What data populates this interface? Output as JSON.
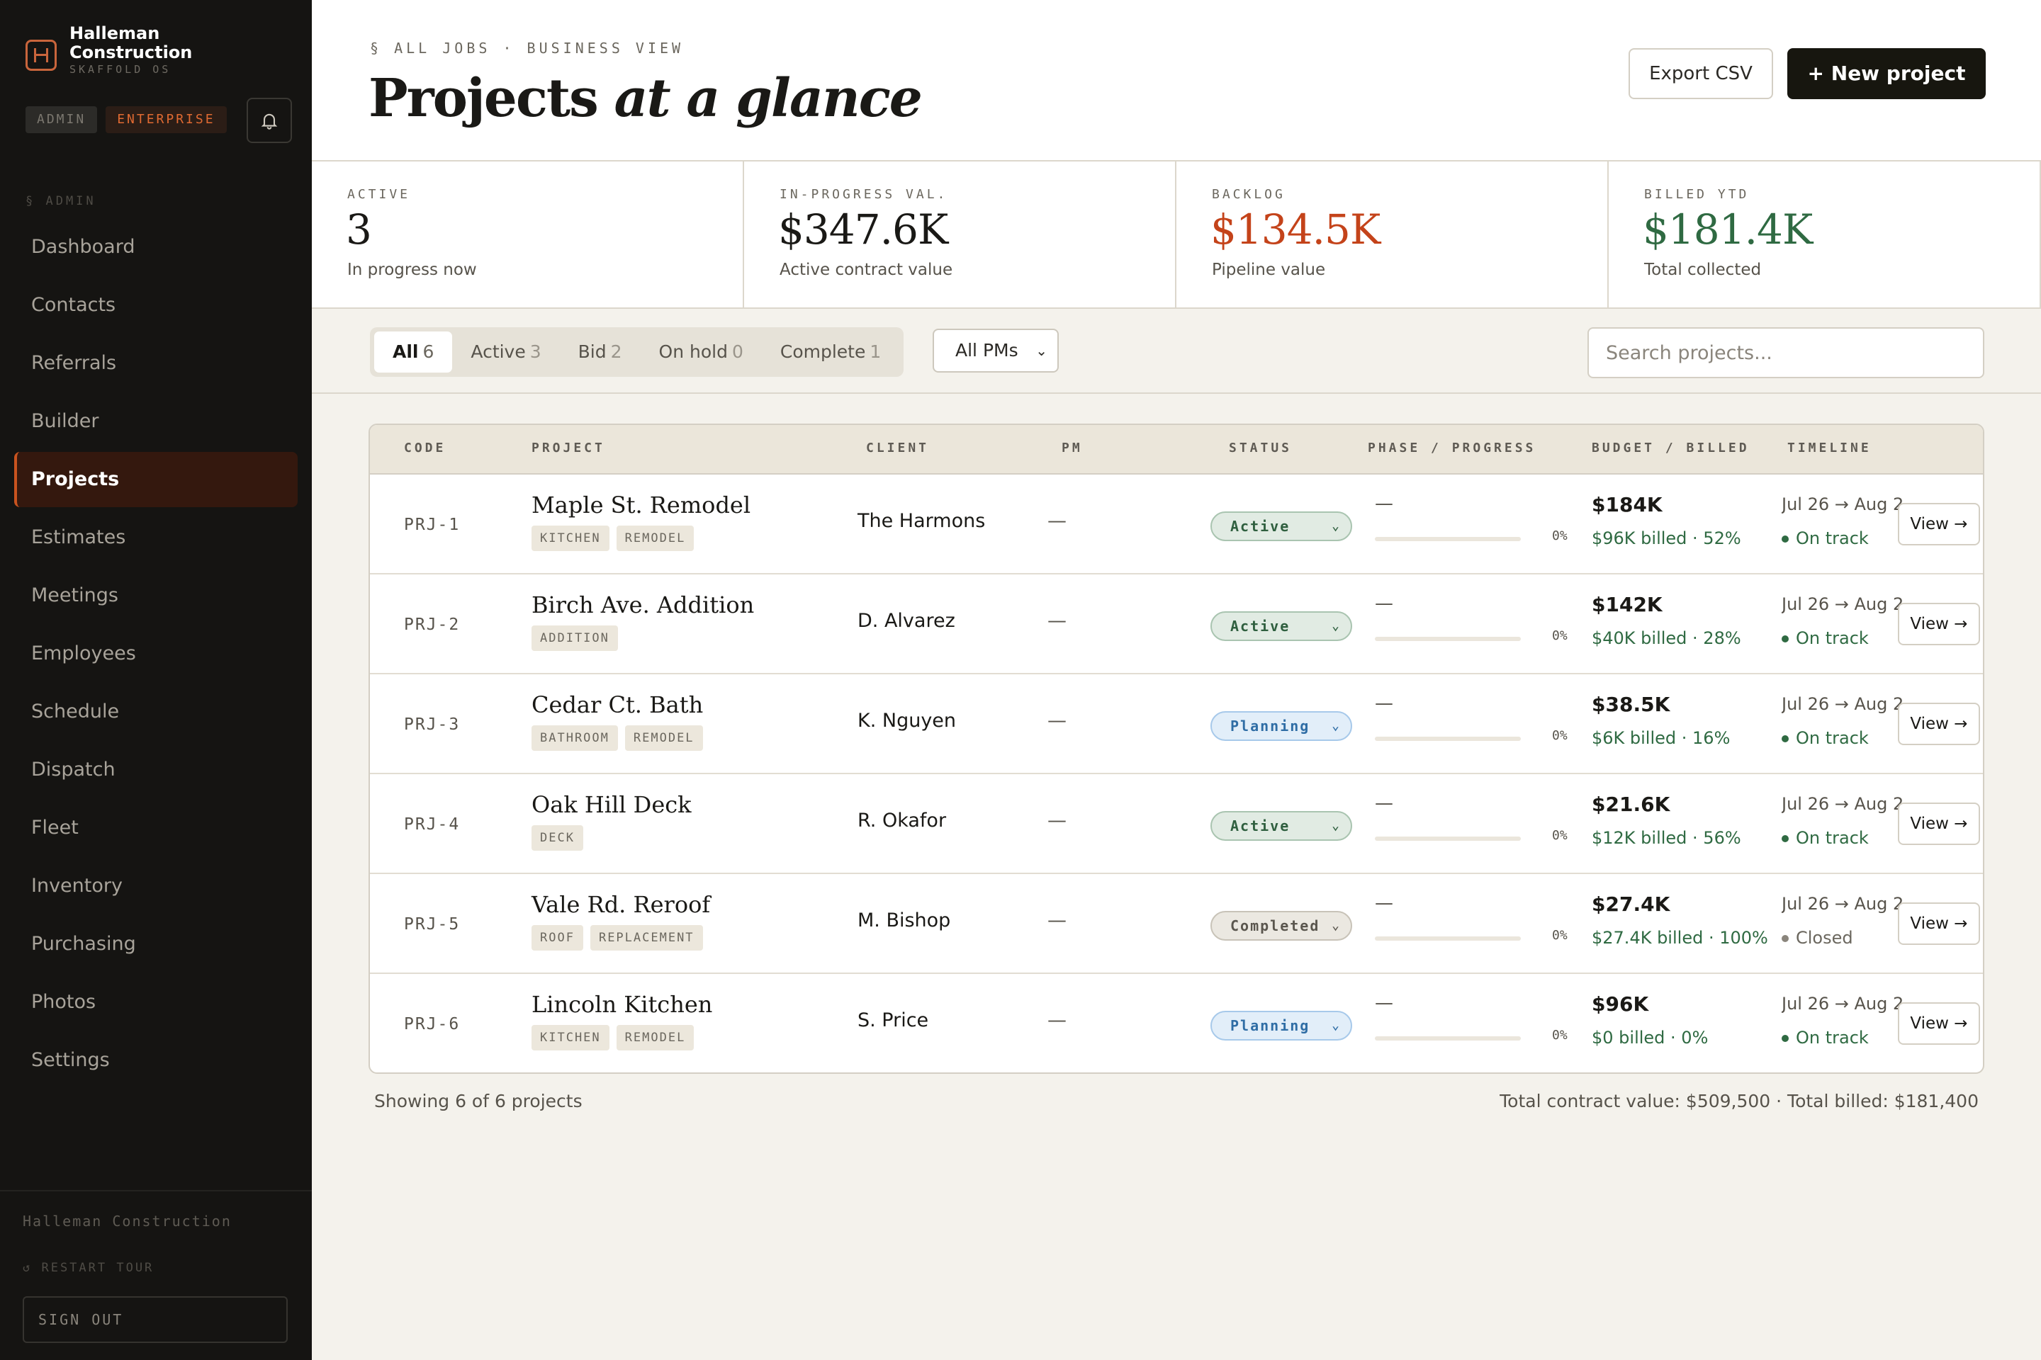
{
  "brand": {
    "name": "Halleman Construction",
    "sub": "SKAFFOLD OS"
  },
  "badges": {
    "admin": "ADMIN",
    "enterprise": "ENTERPRISE"
  },
  "sidebar": {
    "section_label": "§ ADMIN",
    "items": [
      {
        "label": "Dashboard"
      },
      {
        "label": "Contacts"
      },
      {
        "label": "Referrals"
      },
      {
        "label": "Builder"
      },
      {
        "label": "Projects",
        "active": true
      },
      {
        "label": "Estimates"
      },
      {
        "label": "Meetings"
      },
      {
        "label": "Employees"
      },
      {
        "label": "Schedule"
      },
      {
        "label": "Dispatch"
      },
      {
        "label": "Fleet"
      },
      {
        "label": "Inventory"
      },
      {
        "label": "Purchasing"
      },
      {
        "label": "Photos"
      },
      {
        "label": "Settings"
      }
    ],
    "footer_company": "Halleman Construction",
    "restart_tour": "↺ RESTART TOUR",
    "sign_out": "SIGN OUT"
  },
  "header": {
    "eyebrow": "§ ALL JOBS · BUSINESS VIEW",
    "title_main": "Projects ",
    "title_em": "at a glance",
    "export_label": "Export CSV",
    "new_label": "+ New project"
  },
  "stats": [
    {
      "label": "ACTIVE",
      "value": "3",
      "sub": "In progress now",
      "color": "#1a1916"
    },
    {
      "label": "IN-PROGRESS VAL.",
      "value": "$347.6K",
      "sub": "Active contract value",
      "color": "#1a1916"
    },
    {
      "label": "BACKLOG",
      "value": "$134.5K",
      "sub": "Pipeline value",
      "color": "#c4431a"
    },
    {
      "label": "BILLED YTD",
      "value": "$181.4K",
      "sub": "Total collected",
      "color": "#2f6a42"
    }
  ],
  "filters": {
    "tabs": [
      {
        "label": "All",
        "count": "6",
        "active": true
      },
      {
        "label": "Active",
        "count": "3"
      },
      {
        "label": "Bid",
        "count": "2"
      },
      {
        "label": "On hold",
        "count": "0"
      },
      {
        "label": "Complete",
        "count": "1"
      }
    ],
    "pm_select": "All PMs",
    "search_placeholder": "Search projects..."
  },
  "table": {
    "columns": {
      "code": "CODE",
      "project": "PROJECT",
      "client": "CLIENT",
      "pm": "PM",
      "status": "STATUS",
      "phase": "PHASE / PROGRESS",
      "budget": "BUDGET / BILLED",
      "timeline": "TIMELINE"
    },
    "rows": [
      {
        "code": "PRJ-1",
        "name": "Maple St. Remodel",
        "tags": [
          "KITCHEN",
          "REMODEL"
        ],
        "client": "The Harmons",
        "pm": "—",
        "status": "Active",
        "status_kind": "active",
        "phase": "—",
        "progress": "0%",
        "budget": "$184K",
        "billed": "$96K billed · 52%",
        "timeline": "Jul 26 → Aug 26",
        "track": "On track",
        "view": "View →"
      },
      {
        "code": "PRJ-2",
        "name": "Birch Ave. Addition",
        "tags": [
          "ADDITION"
        ],
        "client": "D. Alvarez",
        "pm": "—",
        "status": "Active",
        "status_kind": "active",
        "phase": "—",
        "progress": "0%",
        "budget": "$142K",
        "billed": "$40K billed · 28%",
        "timeline": "Jul 26 → Aug 26",
        "track": "On track",
        "view": "View →"
      },
      {
        "code": "PRJ-3",
        "name": "Cedar Ct. Bath",
        "tags": [
          "BATHROOM",
          "REMODEL"
        ],
        "client": "K. Nguyen",
        "pm": "—",
        "status": "Planning",
        "status_kind": "planning",
        "phase": "—",
        "progress": "0%",
        "budget": "$38.5K",
        "billed": "$6K billed · 16%",
        "timeline": "Jul 26 → Aug 26",
        "track": "On track",
        "view": "View →"
      },
      {
        "code": "PRJ-4",
        "name": "Oak Hill Deck",
        "tags": [
          "DECK"
        ],
        "client": "R. Okafor",
        "pm": "—",
        "status": "Active",
        "status_kind": "active",
        "phase": "—",
        "progress": "0%",
        "budget": "$21.6K",
        "billed": "$12K billed · 56%",
        "timeline": "Jul 26 → Aug 26",
        "track": "On track",
        "view": "View →"
      },
      {
        "code": "PRJ-5",
        "name": "Vale Rd. Reroof",
        "tags": [
          "ROOF",
          "REPLACEMENT"
        ],
        "client": "M. Bishop",
        "pm": "—",
        "status": "Completed",
        "status_kind": "completed",
        "phase": "—",
        "progress": "0%",
        "budget": "$27.4K",
        "billed": "$27.4K billed · 100%",
        "timeline": "Jul 26 → Aug 26",
        "track": "Closed",
        "view": "View →"
      },
      {
        "code": "PRJ-6",
        "name": "Lincoln Kitchen",
        "tags": [
          "KITCHEN",
          "REMODEL"
        ],
        "client": "S. Price",
        "pm": "—",
        "status": "Planning",
        "status_kind": "planning",
        "phase": "—",
        "progress": "0%",
        "budget": "$96K",
        "billed": "$0 billed · 0%",
        "timeline": "Jul 26 → Aug 26",
        "track": "On track",
        "view": "View →"
      }
    ]
  },
  "footer": {
    "showing": "Showing 6 of 6 projects",
    "totals": "Total contract value: $509,500 · Total billed: $181,400"
  }
}
